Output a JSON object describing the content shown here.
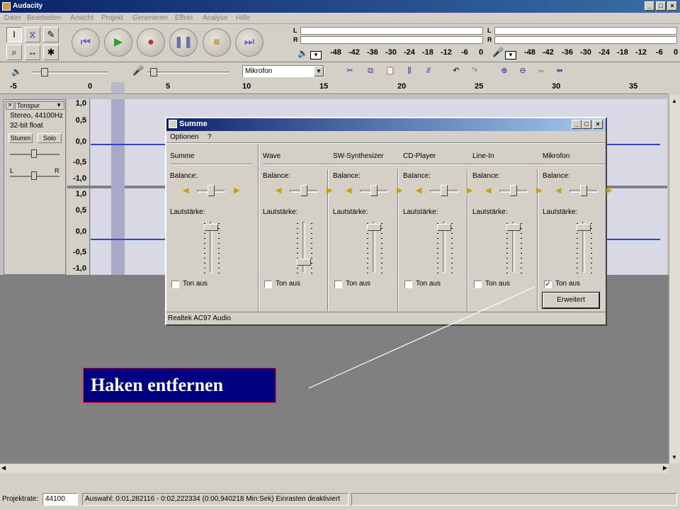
{
  "app": {
    "title": "Audacity"
  },
  "menu": [
    "Datei",
    "Bearbeiten",
    "Ansicht",
    "Projekt",
    "Generieren",
    "Effekt",
    "Analyse",
    "Hilfe"
  ],
  "meters": {
    "play_labels": [
      "L",
      "R"
    ],
    "rec_labels": [
      "L",
      "R"
    ],
    "scale": [
      "-48",
      "-42",
      "-36",
      "-30",
      "-24",
      "-18",
      "-12",
      "-6",
      "0"
    ]
  },
  "mixer_toolbar": {
    "input_source": "Mikrofon"
  },
  "ruler": [
    "-5",
    "0",
    "5",
    "10",
    "15",
    "20",
    "25",
    "30",
    "35"
  ],
  "track": {
    "name": "Tonspur",
    "info1": "Stereo, 44100Hz",
    "info2": "32-bit float",
    "mute": "Stumm",
    "solo": "Solo",
    "left": "L",
    "right": "R",
    "scale": [
      "1,0",
      "0,5",
      "0,0",
      "-0,5",
      "-1,0"
    ]
  },
  "dialog": {
    "title": "Summe",
    "menu_options": "Optionen",
    "menu_help": "?",
    "balance_label": "Balance:",
    "volume_label": "Lautstärke:",
    "mute_label": "Ton aus",
    "advanced_button": "Erweitert",
    "status": "Realtek AC97 Audio",
    "channels": [
      {
        "name": "Summe",
        "muted": false,
        "balance": 0.5,
        "volume": 0.93
      },
      {
        "name": "Wave",
        "muted": false,
        "balance": 0.5,
        "volume": 0.25
      },
      {
        "name": "SW-Synthesizer",
        "muted": false,
        "balance": 0.5,
        "volume": 0.93
      },
      {
        "name": "CD-Player",
        "muted": false,
        "balance": 0.5,
        "volume": 0.93
      },
      {
        "name": "Line-In",
        "muted": false,
        "balance": 0.5,
        "volume": 0.93
      },
      {
        "name": "Mikrofon",
        "muted": true,
        "balance": 0.5,
        "volume": 0.93
      }
    ]
  },
  "status": {
    "rate_label": "Projektrate:",
    "rate_value": "44100",
    "selection": "Auswahl: 0:01,282116 - 0:02,222334 (0:00,940218 Min:Sek)   Einrasten deaktiviert"
  },
  "callout": "Haken entfernen"
}
